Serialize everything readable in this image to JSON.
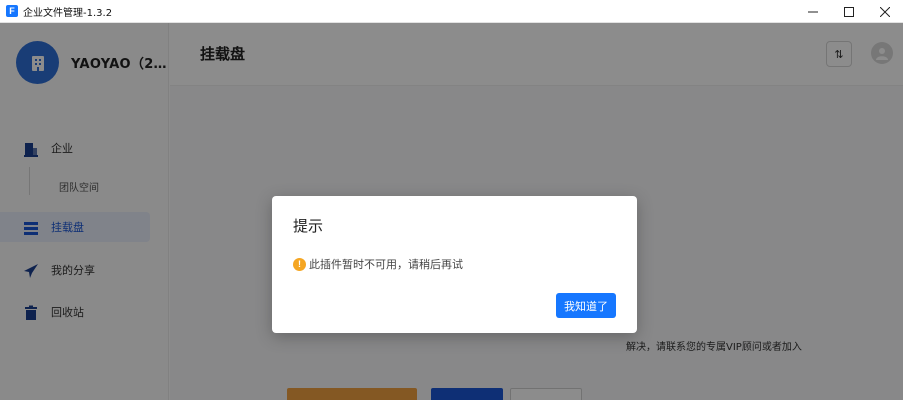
{
  "window": {
    "title": "企业文件管理-1.3.2",
    "icon": "app-logo-icon"
  },
  "sidebar": {
    "profile_name": "YAOYAO（2…",
    "items": [
      {
        "label": "企业",
        "icon": "enterprise-icon"
      },
      {
        "label": "团队空间",
        "icon": ""
      },
      {
        "label": "挂载盘",
        "icon": "mount-disk-icon",
        "active": true
      },
      {
        "label": "我的分享",
        "icon": "share-icon"
      },
      {
        "label": "回收站",
        "icon": "trash-icon"
      }
    ]
  },
  "main": {
    "title": "挂载盘",
    "sort_label": "⇅",
    "background_text": "解决，请联系您的专属VIP顾问或者加入"
  },
  "modal": {
    "title": "提示",
    "message": "此插件暂时不可用，请稍后再试",
    "ok_label": "我知道了"
  },
  "colors": {
    "accent": "#1677ff",
    "sidebar_active": "#1a56d6",
    "warning": "#f5a623",
    "avatar": "#2f6fd8"
  }
}
